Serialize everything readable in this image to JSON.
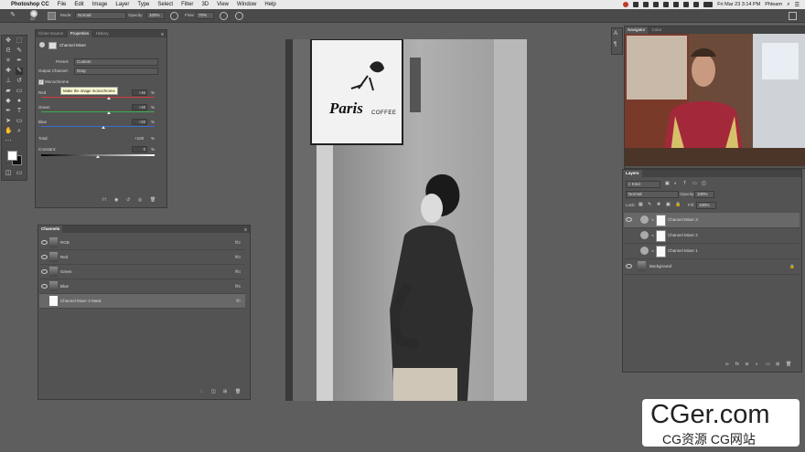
{
  "menubar": {
    "app": "Photoshop CC",
    "items": [
      "File",
      "Edit",
      "Image",
      "Layer",
      "Type",
      "Select",
      "Filter",
      "3D",
      "View",
      "Window",
      "Help"
    ],
    "datetime": "Fri Mar 23  3:14 PM",
    "user": "Phlearn"
  },
  "options": {
    "brush_size": "347",
    "mode_label": "Mode:",
    "mode_value": "Normal",
    "opacity_label": "Opacity:",
    "opacity_value": "100%",
    "flow_label": "Flow:",
    "flow_value": "70%"
  },
  "properties_panel": {
    "tabs": [
      "Clone Source",
      "Properties",
      "History"
    ],
    "title": "Channel Mixer",
    "preset_label": "Preset:",
    "preset_value": "Custom",
    "output_label": "Output Channel:",
    "output_value": "Gray",
    "monochrome_label": "Monochrome",
    "tooltip": "Make the image monochrome",
    "sliders": [
      {
        "label": "Red",
        "value": "+40",
        "unit": "%",
        "level": 40,
        "color": "#d23b3b"
      },
      {
        "label": "Green",
        "value": "+40",
        "unit": "%",
        "level": 40,
        "color": "#3ab04a"
      },
      {
        "label": "Blue",
        "value": "+20",
        "unit": "%",
        "level": 20,
        "color": "#3a6ed2"
      }
    ],
    "total_label": "Total:",
    "total_value": "+100",
    "total_unit": "%",
    "constant_label": "Constant:",
    "constant_value": "0",
    "constant_unit": "%"
  },
  "channels_panel": {
    "title": "Channels",
    "rows": [
      {
        "name": "RGB",
        "key": "⌘2"
      },
      {
        "name": "Red",
        "key": "⌘3"
      },
      {
        "name": "Green",
        "key": "⌘4"
      },
      {
        "name": "Blue",
        "key": "⌘5"
      },
      {
        "name": "Channel Mixer 3 Mask",
        "key": "⌘\\"
      }
    ]
  },
  "canvas": {
    "sign_title": "Paris",
    "sign_sub": "COFFEE"
  },
  "navigator_panel": {
    "tabs": [
      "Navigator",
      "Color"
    ]
  },
  "layers_panel": {
    "title": "Layers",
    "kind_label": "Kind",
    "blend_value": "Normal",
    "opacity_label": "Opacity:",
    "opacity_value": "100%",
    "lock_label": "Lock:",
    "fill_label": "Fill:",
    "fill_value": "100%",
    "layers": [
      {
        "name": "Channel Mixer 3",
        "selected": true
      },
      {
        "name": "Channel Mixer 2",
        "selected": false
      },
      {
        "name": "Channel Mixer 1",
        "selected": false
      },
      {
        "name": "Background",
        "selected": false
      }
    ]
  },
  "watermark": {
    "brand": "CGer.com",
    "sub": "CG资源 CG网站"
  },
  "colors": {
    "ui_bg": "#5e5e5e",
    "panel_bg": "#535353",
    "selected_row": "#686868"
  }
}
